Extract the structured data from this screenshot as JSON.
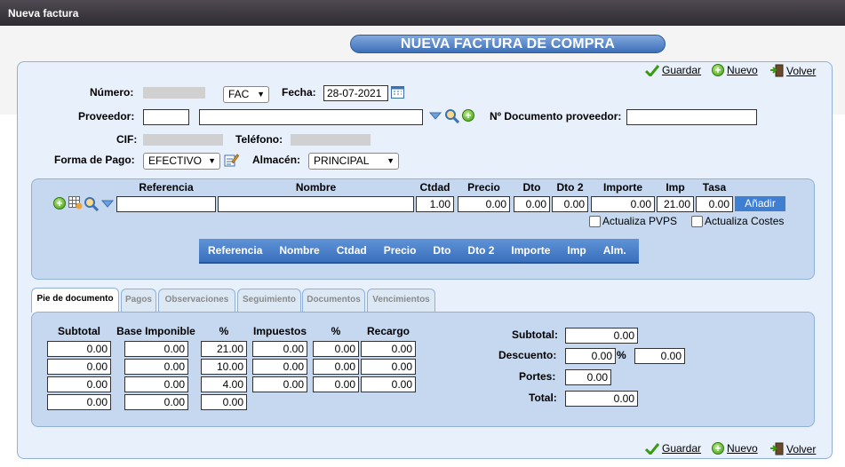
{
  "window": {
    "title": "Nueva factura"
  },
  "page_title": "NUEVA FACTURA DE COMPRA",
  "actions": {
    "save": "Guardar",
    "new": "Nuevo",
    "back": "Volver"
  },
  "form": {
    "numero_label": "Número:",
    "serie": "FAC",
    "fecha_label": "Fecha:",
    "fecha": "28-07-2021",
    "proveedor_label": "Proveedor:",
    "ndoc_label": "Nº Documento proveedor:",
    "cif_label": "CIF:",
    "telefono_label": "Teléfono:",
    "forma_pago_label": "Forma de Pago:",
    "forma_pago": "EFECTIVO",
    "almacen_label": "Almacén:",
    "almacen": "PRINCIPAL"
  },
  "lines": {
    "headers": [
      "Referencia",
      "Nombre",
      "Ctdad",
      "Precio",
      "Dto",
      "Dto 2",
      "Importe",
      "Imp",
      "Tasa"
    ],
    "values": {
      "ctdad": "1.00",
      "precio": "0.00",
      "dto": "0.00",
      "dto2": "0.00",
      "importe": "0.00",
      "imp": "21.00",
      "tasa": "0.00"
    },
    "add_button": "Añadir",
    "actualiza_pvps": "Actualiza PVPS",
    "actualiza_costes": "Actualiza Costes",
    "grid_headers": [
      "Referencia",
      "Nombre",
      "Ctdad",
      "Precio",
      "Dto",
      "Dto 2",
      "Importe",
      "Imp",
      "Alm."
    ]
  },
  "tabs": [
    "Pie de documento",
    "Pagos",
    "Observaciones",
    "Seguimiento",
    "Documentos",
    "Vencimientos"
  ],
  "taxes": {
    "headers": [
      "Subtotal",
      "Base Imponible",
      "%",
      "Impuestos",
      "%",
      "Recargo"
    ],
    "rows": [
      [
        "0.00",
        "0.00",
        "21.00",
        "0.00",
        "0.00",
        "0.00"
      ],
      [
        "0.00",
        "0.00",
        "10.00",
        "0.00",
        "0.00",
        "0.00"
      ],
      [
        "0.00",
        "0.00",
        "4.00",
        "0.00",
        "0.00",
        "0.00"
      ],
      [
        "0.00",
        "0.00",
        "0.00"
      ]
    ]
  },
  "totals": {
    "subtotal_label": "Subtotal:",
    "subtotal": "0.00",
    "descuento_label": "Descuento:",
    "descuento_pct": "0.00",
    "pct_sign": "%",
    "descuento_val": "0.00",
    "portes_label": "Portes:",
    "portes": "0.00",
    "total_label": "Total:",
    "total": "0.00"
  }
}
